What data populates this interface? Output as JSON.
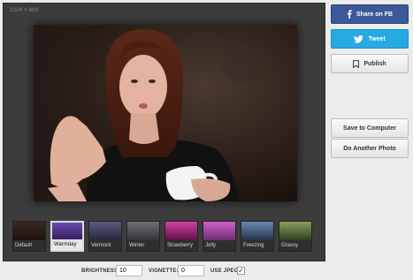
{
  "editor": {
    "dimensions": "1024 × 683"
  },
  "filters": [
    {
      "label": "Default",
      "tint": "#2a1a14"
    },
    {
      "label": "Warmday",
      "tint": "#4a3470"
    },
    {
      "label": "Vermont",
      "tint": "#3a3a5a"
    },
    {
      "label": "Winter",
      "tint": "#4a4a52"
    },
    {
      "label": "Strawberry",
      "tint": "#a0307a"
    },
    {
      "label": "Jolly",
      "tint": "#b04aa0"
    },
    {
      "label": "Freezing",
      "tint": "#3a4a6a"
    },
    {
      "label": "Grassy",
      "tint": "#5a6a3a"
    }
  ],
  "selected_filter": "Warmday",
  "controls": {
    "brightness_label": "BRIGHTNESS:",
    "brightness_value": "10",
    "vignette_label": "VIGNETTE:",
    "vignette_value": "0",
    "jpeg_label": "USE JPEG",
    "jpeg_checked": true
  },
  "sidebar": {
    "facebook_label": "Share on FB",
    "twitter_label": "Tweet",
    "publish_label": "Publish",
    "save_label": "Save to Computer",
    "another_label": "Do Another Photo"
  },
  "colors": {
    "facebook": "#3b5998",
    "twitter": "#27a9e1",
    "panel_bg": "#3c3c3c"
  }
}
